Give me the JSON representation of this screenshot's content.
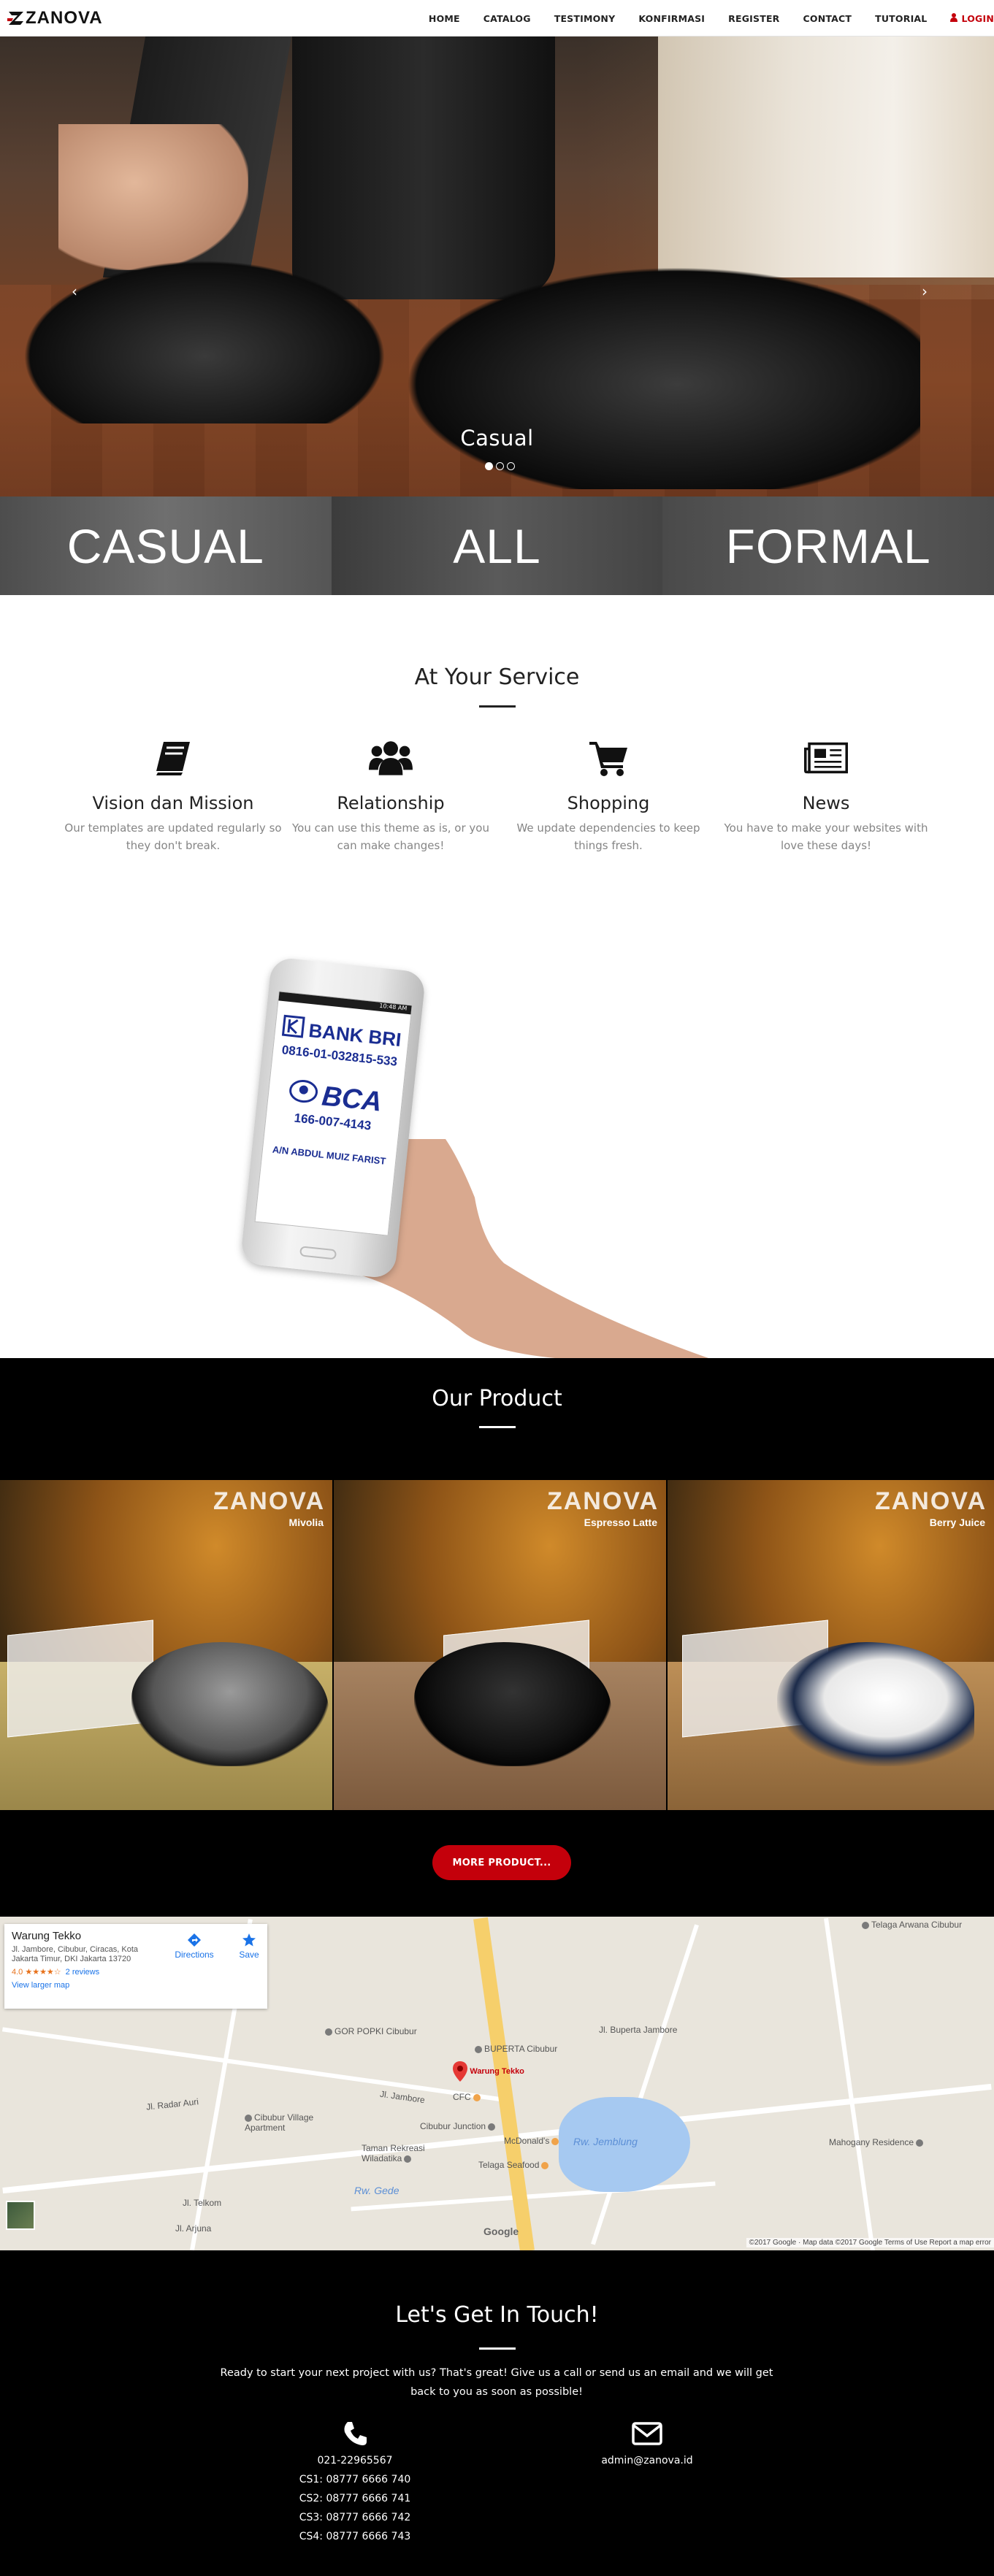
{
  "nav": {
    "logo": "ZANOVA",
    "items": [
      "HOME",
      "CATALOG",
      "TESTIMONY",
      "KONFIRMASI",
      "REGISTER",
      "CONTACT",
      "TUTORIAL"
    ],
    "login": "LOGIN"
  },
  "hero": {
    "caption": "Casual",
    "arrow_left": "‹",
    "arrow_right": "›",
    "slides": 3,
    "active_slide": 1
  },
  "categories": [
    "CASUAL",
    "ALL",
    "FORMAL"
  ],
  "service": {
    "title": "At Your Service",
    "items": [
      {
        "icon": "book-icon",
        "title": "Vision dan Mission",
        "text": "Our templates are updated regularly so they don't break."
      },
      {
        "icon": "users-icon",
        "title": "Relationship",
        "text": "You can use this theme as is, or you can make changes!"
      },
      {
        "icon": "cart-icon",
        "title": "Shopping",
        "text": "We update dependencies to keep things fresh."
      },
      {
        "icon": "newspaper-icon",
        "title": "News",
        "text": "You have to make your websites with love these days!"
      }
    ]
  },
  "payment": {
    "bri_name": "BANK BRI",
    "bri_number": "0816-01-032815-533",
    "bca_name": "BCA",
    "bca_number": "166-007-4143",
    "account_name": "A/N ABDUL MUIZ FARIST",
    "status_time": "10:48 AM"
  },
  "products": {
    "title": "Our Product",
    "brand": "ZANOVA",
    "items": [
      {
        "name": "Mivolia"
      },
      {
        "name": "Espresso Latte"
      },
      {
        "name": "Berry Juice"
      }
    ],
    "more_button": "MORE PRODUCT..."
  },
  "map": {
    "place_name": "Warung Tekko",
    "address": "Jl. Jambore, Cibubur, Ciracas, Kota Jakarta Timur, DKI Jakarta 13720",
    "rating": "4.0 ★★★★☆",
    "reviews": "2 reviews",
    "larger_map": "View larger map",
    "directions": "Directions",
    "save": "Save",
    "labels": {
      "kebon": "Telaga Arwana Cibubur",
      "bupertajambore": "Jl. Buperta Jambore",
      "goor": "GOR POPKI Cibubur",
      "buperta": "BUPERTA Cibubur",
      "warung": "Warung Tekko",
      "cfc": "CFC",
      "village": "Cibubur Village Apartment",
      "junction": "Cibubur Junction",
      "mcd": "McDonald's",
      "taman": "Taman Rekreasi Wiladatika",
      "seafood": "Telaga Seafood",
      "jemblung": "Rw. Jemblung",
      "gede": "Rw. Gede",
      "mahogany": "Mahogany Residence",
      "radar": "Jl. Radar Auri",
      "jambore": "Jl. Jambore",
      "telkom": "Jl. Telkom",
      "arjuna": "Jl. Arjuna"
    },
    "attribution": "©2017 Google · Map data ©2017 Google   Terms of Use   Report a map error",
    "google": "Google"
  },
  "contact": {
    "title": "Let's Get In Touch!",
    "intro": "Ready to start your next project with us? That's great! Give us a call or send us an email and we will get back to you as soon as possible!",
    "phones": [
      "021-22965567",
      "CS1: 08777 6666 740",
      "CS2: 08777 6666 741",
      "CS3: 08777 6666 742",
      "CS4: 08777 6666 743"
    ],
    "email": "admin@zanova.id"
  },
  "colors": {
    "accent": "#c4000b",
    "dark": "#000000",
    "muted": "#858585"
  }
}
